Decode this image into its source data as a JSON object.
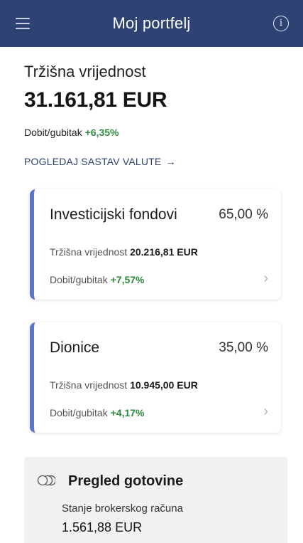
{
  "header": {
    "title": "Moj portfelj",
    "menu_icon": "hamburger-menu-icon",
    "info_icon": "info-icon",
    "info_glyph": "i",
    "background": "#2e4374"
  },
  "portfolio": {
    "market_value_label": "Tržišna vrijednost",
    "market_value": "31.161,81 EUR",
    "pl_label": "Dobit/gubitak",
    "pl_value": "+6,35%",
    "currency_link": "POGLEDAJ SASTAV VALUTE",
    "currency_link_arrow": "→"
  },
  "cards": [
    {
      "name": "Investicijski fondovi",
      "percent": "65,00 %",
      "mv_label": "Tržišna vrijednost",
      "mv_value": "20.216,81 EUR",
      "pl_label": "Dobit/gubitak",
      "pl_value": "+7,57%",
      "chevron": "›"
    },
    {
      "name": "Dionice",
      "percent": "35,00 %",
      "mv_label": "Tržišna vrijednost",
      "mv_value": "10.945,00 EUR",
      "pl_label": "Dobit/gubitak",
      "pl_value": "+4,17%",
      "chevron": "›"
    }
  ],
  "cash": {
    "icon": "cash-coins-icon",
    "title": "Pregled gotovine",
    "balance_label": "Stanje brokerskog računa",
    "balance_value": "1.561,88 EUR"
  },
  "colors": {
    "accent": "#5a75c9",
    "positive": "#2f8a3e",
    "link": "#2b3f6d"
  }
}
